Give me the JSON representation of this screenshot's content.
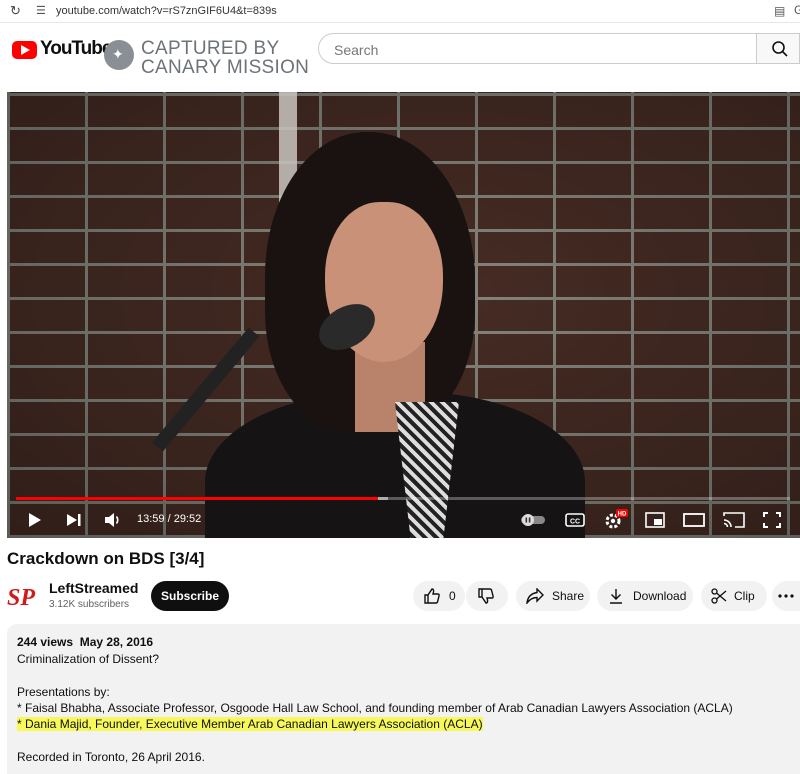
{
  "browser": {
    "url": "youtube.com/watch?v=rS7znGIF6U4&t=839s",
    "icons": [
      "reload-icon",
      "site-info-icon",
      "install-icon",
      "profile-icon"
    ]
  },
  "header": {
    "logo_text": "YouTube",
    "overlay": {
      "line1": "CAPTURED BY",
      "line2": "CANARY MISSION"
    },
    "search_placeholder": "Search"
  },
  "player": {
    "current_time": "13:59",
    "duration": "29:52",
    "time_display": "13:59 / 29:52",
    "progress_fraction": 0.468,
    "buffered_fraction": 0.48,
    "hd_badge": "HD",
    "cc_label": "CC"
  },
  "video": {
    "title": "Crackdown on BDS [3/4]"
  },
  "channel": {
    "avatar_text": "SP",
    "name": "LeftStreamed",
    "subscribers": "3.12K subscribers",
    "subscribe_label": "Subscribe"
  },
  "actions": {
    "like_count": "0",
    "share_label": "Share",
    "download_label": "Download",
    "clip_label": "Clip"
  },
  "description": {
    "views": "244 views",
    "date": "May 28, 2016",
    "line1": "Criminalization of Dissent?",
    "line2": "Presentations by:",
    "line3": "* Faisal Bhabha, Associate Professor, Osgoode Hall Law School, and founding member of Arab Canadian Lawyers Association (ACLA)",
    "line4_highlighted": "* Dania Majid, Founder, Executive Member Arab Canadian Lawyers Association (ACLA)",
    "line5": "Recorded in Toronto, 26 April 2016.",
    "highlight_color": "#f7f95a"
  },
  "colors": {
    "brand_red": "#ff0000",
    "subscribe_bg": "#0f0f0f",
    "pill_bg": "#f2f2f2"
  }
}
